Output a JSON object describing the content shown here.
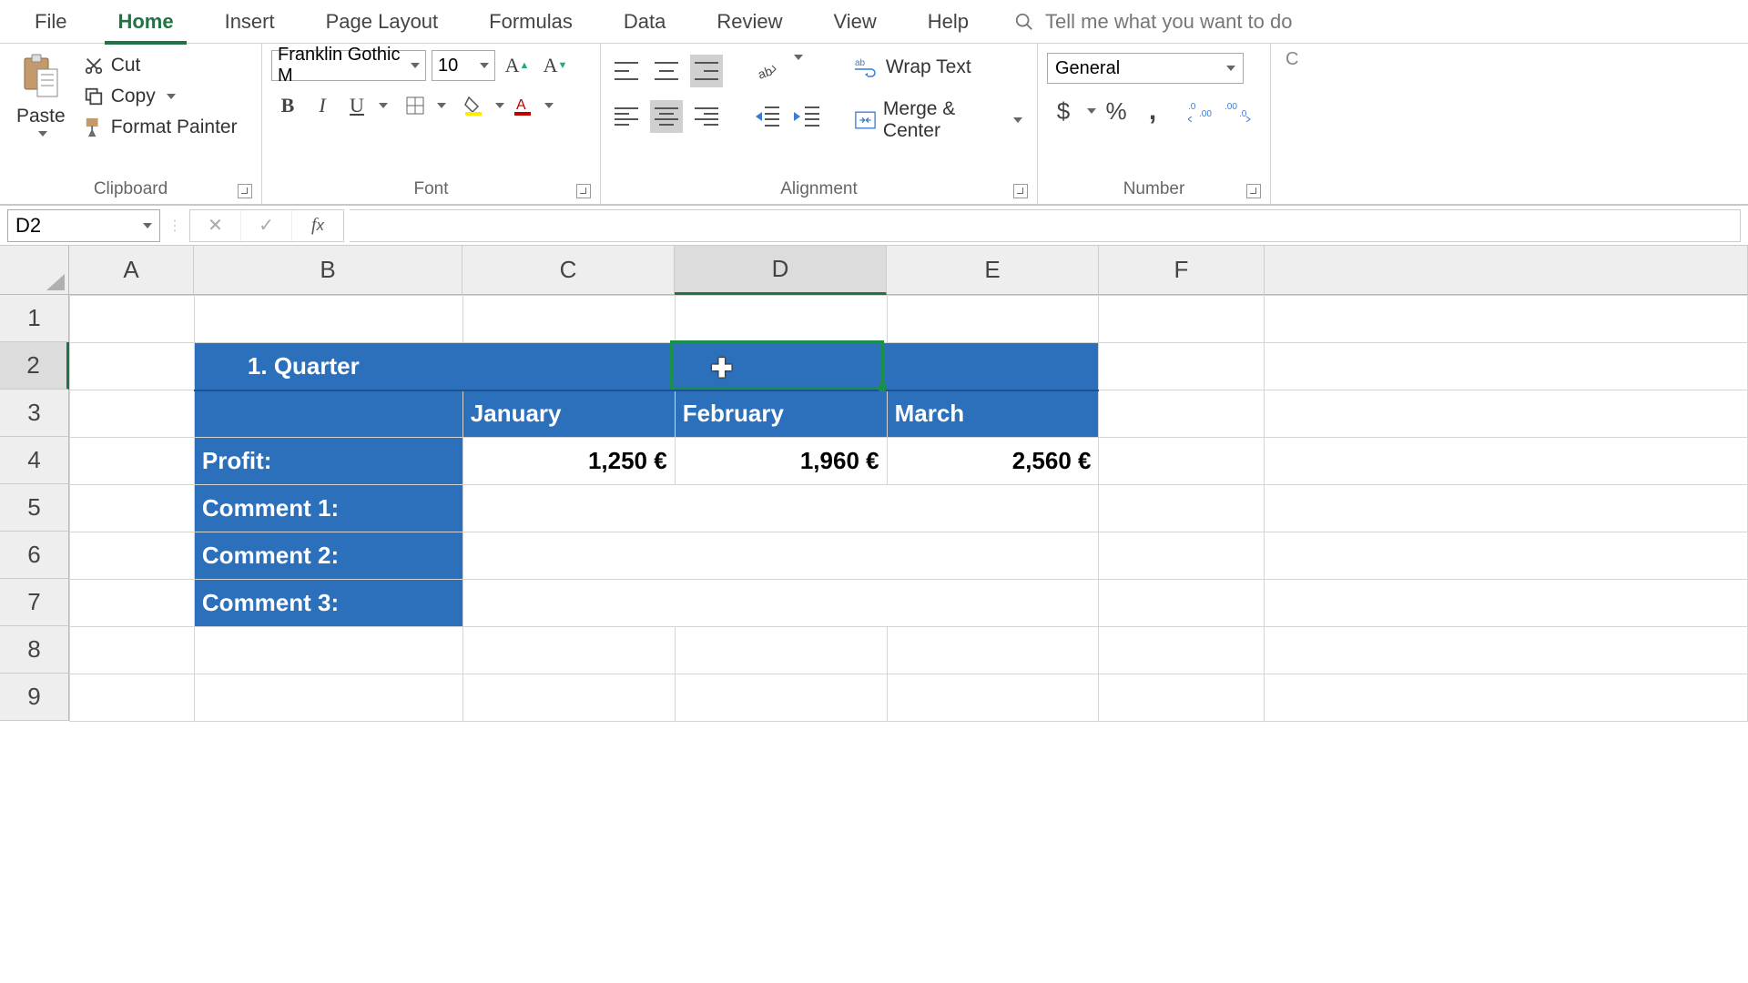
{
  "tabs": {
    "file": "File",
    "home": "Home",
    "insert": "Insert",
    "page_layout": "Page Layout",
    "formulas": "Formulas",
    "data": "Data",
    "review": "Review",
    "view": "View",
    "help": "Help",
    "tell_me": "Tell me what you want to do"
  },
  "ribbon": {
    "clipboard": {
      "paste": "Paste",
      "cut": "Cut",
      "copy": "Copy",
      "format_painter": "Format Painter",
      "label": "Clipboard"
    },
    "font": {
      "name": "Franklin Gothic M",
      "size": "10",
      "label": "Font"
    },
    "alignment": {
      "wrap": "Wrap Text",
      "merge": "Merge & Center",
      "label": "Alignment"
    },
    "number": {
      "format": "General",
      "label": "Number"
    }
  },
  "namebox": "D2",
  "formula": "",
  "columns": [
    "A",
    "B",
    "C",
    "D",
    "E",
    "F"
  ],
  "rows": [
    "1",
    "2",
    "3",
    "4",
    "5",
    "6",
    "7",
    "8",
    "9"
  ],
  "sheet": {
    "title": "1. Quarter",
    "months": {
      "c": "January",
      "d": "February",
      "e": "March"
    },
    "profit_label": "Profit:",
    "profit": {
      "c": "1,250 €",
      "d": "1,960 €",
      "e": "2,560 €"
    },
    "comment1": "Comment 1:",
    "comment2": "Comment 2:",
    "comment3": "Comment 3:"
  },
  "chart_data": {
    "type": "table",
    "title": "1. Quarter",
    "categories": [
      "January",
      "February",
      "March"
    ],
    "series": [
      {
        "name": "Profit",
        "values": [
          1250,
          1960,
          2560
        ],
        "unit": "€"
      }
    ]
  }
}
